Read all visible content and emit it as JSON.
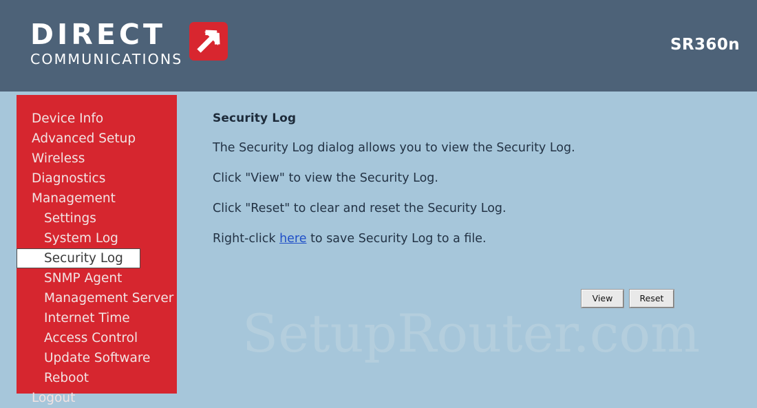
{
  "header": {
    "logo_primary": "DIRECT",
    "logo_secondary": "COMMUNICATIONS",
    "logo_icon": "arrow-up-right-icon",
    "model": "SR360n",
    "background_color": "#4d6278"
  },
  "sidebar": {
    "background_color": "#d6262f",
    "selected_label": "Security Log",
    "items": [
      {
        "label": "Device Info",
        "level": 1,
        "selected": false
      },
      {
        "label": "Advanced Setup",
        "level": 1,
        "selected": false
      },
      {
        "label": "Wireless",
        "level": 1,
        "selected": false
      },
      {
        "label": "Diagnostics",
        "level": 1,
        "selected": false
      },
      {
        "label": "Management",
        "level": 1,
        "selected": false
      },
      {
        "label": "Settings",
        "level": 2,
        "selected": false
      },
      {
        "label": "System Log",
        "level": 2,
        "selected": false
      },
      {
        "label": "Security Log",
        "level": 2,
        "selected": true
      },
      {
        "label": "SNMP Agent",
        "level": 2,
        "selected": false
      },
      {
        "label": "Management Server",
        "level": 2,
        "selected": false
      },
      {
        "label": "Internet Time",
        "level": 2,
        "selected": false
      },
      {
        "label": "Access Control",
        "level": 2,
        "selected": false
      },
      {
        "label": "Update Software",
        "level": 2,
        "selected": false
      },
      {
        "label": "Reboot",
        "level": 2,
        "selected": false
      },
      {
        "label": "Logout",
        "level": 1,
        "selected": false
      }
    ]
  },
  "main": {
    "background_color": "#a6c6da",
    "title": "Security Log",
    "paragraph_1": "The Security Log dialog allows you to view the Security Log.",
    "paragraph_2": "Click \"View\" to view the Security Log.",
    "paragraph_3": "Click \"Reset\" to clear and reset the Security Log.",
    "paragraph_4_prefix": "Right-click ",
    "paragraph_4_link": "here",
    "paragraph_4_suffix": " to save Security Log to a file.",
    "link_color": "#2050c8",
    "buttons": {
      "view": "View",
      "reset": "Reset"
    }
  },
  "watermark": {
    "text": "SetupRouter.com"
  }
}
